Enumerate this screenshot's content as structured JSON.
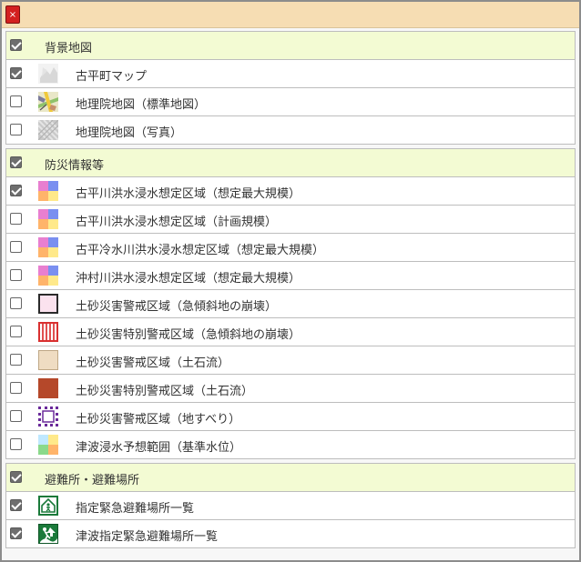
{
  "window": {
    "close_label": "×"
  },
  "groups": [
    {
      "header": {
        "label": "背景地図",
        "checked": true
      },
      "items": [
        {
          "label": "古平町マップ",
          "checked": true,
          "icon": "town-map-thumbnail-icon"
        },
        {
          "label": "地理院地図（標準地図）",
          "checked": false,
          "icon": "standard-map-thumbnail-icon"
        },
        {
          "label": "地理院地図（写真）",
          "checked": false,
          "icon": "photo-map-thumbnail-icon"
        }
      ]
    },
    {
      "header": {
        "label": "防災情報等",
        "checked": true
      },
      "items": [
        {
          "label": "古平川洪水浸水想定区域（想定最大規模）",
          "checked": true,
          "icon": "flood-legend-icon"
        },
        {
          "label": "古平川洪水浸水想定区域（計画規模）",
          "checked": false,
          "icon": "flood-legend-icon"
        },
        {
          "label": "古平冷水川洪水浸水想定区域（想定最大規模）",
          "checked": false,
          "icon": "flood-legend-icon"
        },
        {
          "label": "沖村川洪水浸水想定区域（想定最大規模）",
          "checked": false,
          "icon": "flood-legend-icon"
        },
        {
          "label": "土砂災害警戒区域（急傾斜地の崩壊）",
          "checked": false,
          "icon": "pink-box-icon"
        },
        {
          "label": "土砂災害特別警戒区域（急傾斜地の崩壊）",
          "checked": false,
          "icon": "red-striped-box-icon"
        },
        {
          "label": "土砂災害警戒区域（土石流）",
          "checked": false,
          "icon": "beige-box-icon"
        },
        {
          "label": "土砂災害特別警戒区域（土石流）",
          "checked": false,
          "icon": "brown-box-icon"
        },
        {
          "label": "土砂災害警戒区域（地すべり）",
          "checked": false,
          "icon": "purple-dotted-box-icon"
        },
        {
          "label": "津波浸水予想範囲（基準水位）",
          "checked": false,
          "icon": "tsunami-legend-icon"
        }
      ]
    },
    {
      "header": {
        "label": "避難所・避難場所",
        "checked": true
      },
      "items": [
        {
          "label": "指定緊急避難場所一覧",
          "checked": true,
          "icon": "evacuation-site-icon"
        },
        {
          "label": "津波指定緊急避難場所一覧",
          "checked": true,
          "icon": "tsunami-evacuation-icon"
        }
      ]
    }
  ],
  "colors": {
    "titlebar": "#f6ddb3",
    "group_header": "#f3fbd3",
    "close_button": "#d32020",
    "flood_pink": "#e87fd0",
    "flood_blue": "#7a8ff0",
    "flood_orange": "#ffb46a",
    "flood_yellow": "#ffe98a",
    "landslide_brown": "#b5482a",
    "evacuation_green": "#1a7a3a"
  }
}
